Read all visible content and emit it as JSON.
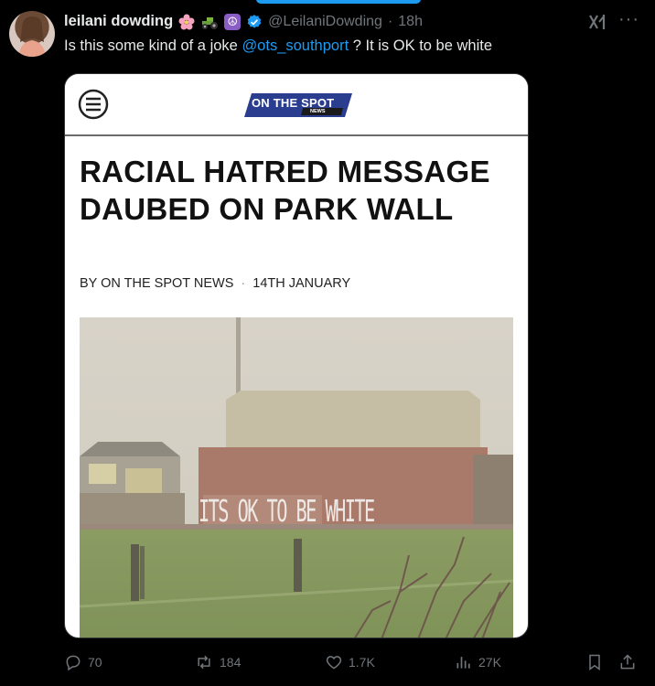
{
  "post": {
    "display_name": "leilani dowding",
    "handle": "@LeilaniDowding",
    "time": "18h",
    "text_before": "Is this some kind of a joke ",
    "mention": "@ots_southport",
    "text_after": " ?  It is OK to be white",
    "badges": [
      "cherry-blossom-emoji",
      "tractor-emoji",
      "peace-symbol-emoji",
      "verified-badge"
    ]
  },
  "card": {
    "logo_text": "ON THE SPOT",
    "logo_sub": "NEWS",
    "headline": "RACIAL HATRED MESSAGE DAUBED ON PARK WALL",
    "byline": "BY ON THE SPOT NEWS",
    "byline_sep": "·",
    "date": "14TH JANUARY",
    "graffiti_text": "ITS OK TO BE WHITE"
  },
  "actions": {
    "replies": "70",
    "reposts": "184",
    "likes": "1.7K",
    "views": "27K"
  },
  "colors": {
    "background": "#000000",
    "text": "#e7e9ea",
    "muted": "#71767b",
    "accent": "#1d9bf0",
    "logo_bg": "#2b3d8f"
  },
  "icons": [
    "grok-icon",
    "more-icon",
    "reply-icon",
    "repost-icon",
    "like-icon",
    "views-icon",
    "bookmark-icon",
    "share-icon",
    "menu-icon"
  ]
}
